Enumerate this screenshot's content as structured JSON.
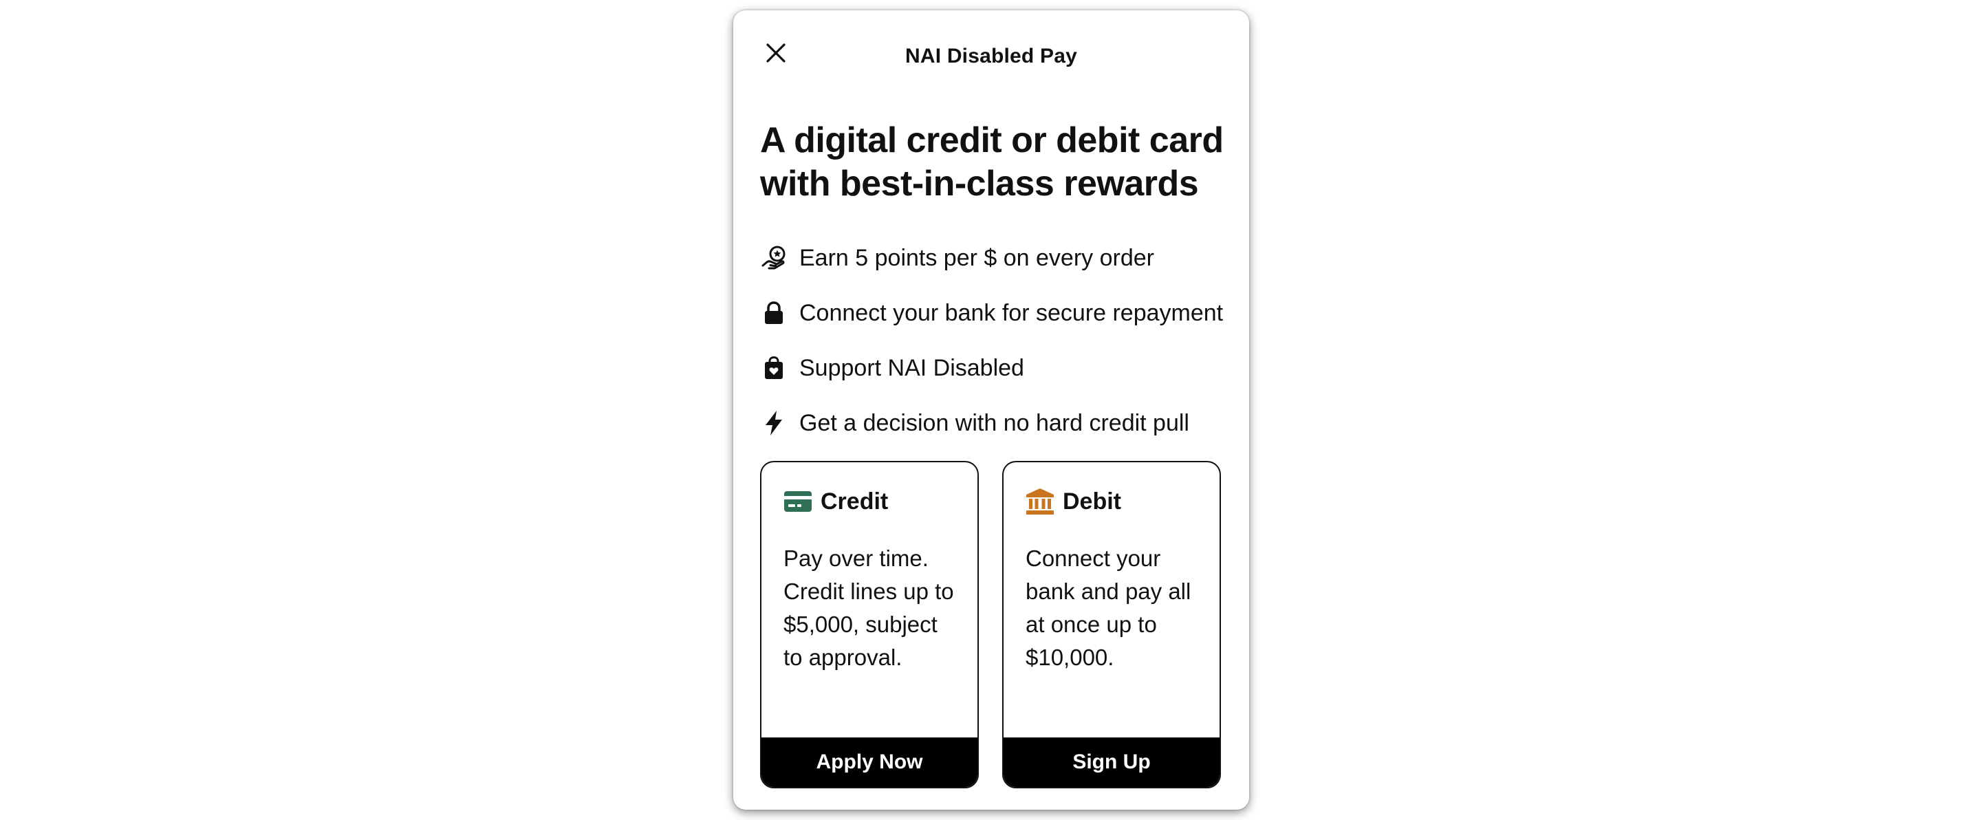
{
  "modal": {
    "title": "NAI Disabled Pay",
    "close_icon": "close-icon"
  },
  "headline": "A digital credit or debit card with best-in-class rewards",
  "features": [
    {
      "icon": "hand-star-icon",
      "text": "Earn 5 points per $ on every order"
    },
    {
      "icon": "lock-icon",
      "text": "Connect your bank for secure repayment"
    },
    {
      "icon": "shopping-bag-heart-icon",
      "text": "Support NAI Disabled"
    },
    {
      "icon": "lightning-icon",
      "text": "Get a decision with no hard credit pull"
    }
  ],
  "cards": {
    "credit": {
      "icon": "credit-card-icon",
      "icon_color": "#2f6f55",
      "title": "Credit",
      "description": "Pay over time. Credit lines up to $5,000, subject to approval.",
      "button_label": "Apply Now"
    },
    "debit": {
      "icon": "bank-icon",
      "icon_color": "#c9741f",
      "title": "Debit",
      "description": "Connect your bank and pay all at once up to $10,000.",
      "button_label": "Sign Up"
    }
  }
}
